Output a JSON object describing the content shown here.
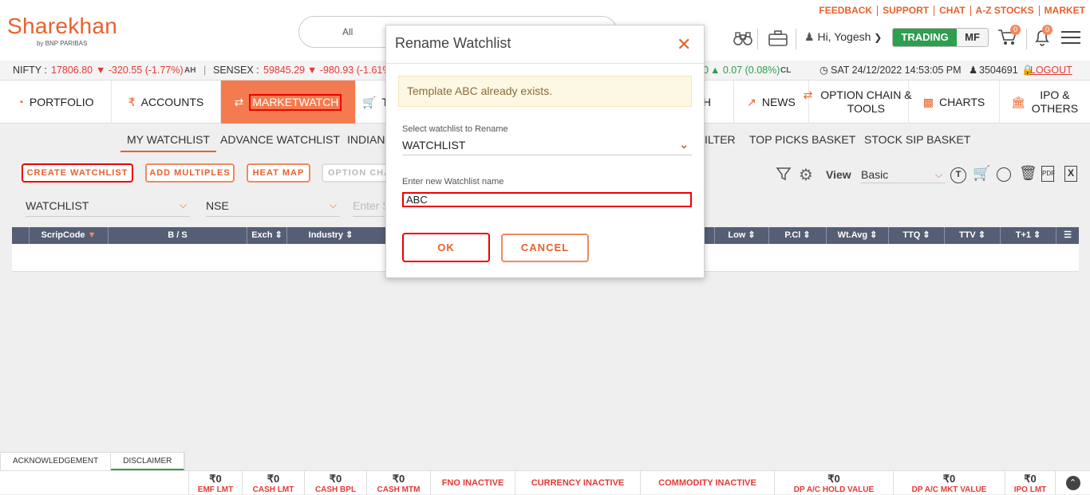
{
  "brand": {
    "name": "Sharekhan",
    "sub": "by BNP PARIBAS"
  },
  "toplinks": [
    "FEEDBACK",
    "SUPPORT",
    "CHAT",
    "A-Z STOCKS",
    "MARKET"
  ],
  "search": {
    "scope": "All"
  },
  "user": {
    "greeting": "Hi, Yogesh"
  },
  "mode": {
    "trading": "TRADING",
    "mf": "MF"
  },
  "badges": {
    "cart": "0",
    "bell": "0"
  },
  "ticker": {
    "nifty_label": "NIFTY :",
    "nifty_value": "17806.80",
    "nifty_change": "▼ -320.55 (-1.77%)",
    "nifty_tag": "AH",
    "sensex_label": "SENSEX :",
    "sensex_value": "59845.29",
    "sensex_change": "▼ -980.93 (-1.61%",
    "other_fragment": "0",
    "other_change": "▲ 0.07 (0.08%)",
    "other_tag": "CL",
    "datetime": "SAT 24/12/2022 14:53:05 PM",
    "user_id": "3504691",
    "logout": "LOGOUT"
  },
  "nav": {
    "portfolio": "PORTFOLIO",
    "accounts": "ACCOUNTS",
    "marketwatch": "MARKETWATCH",
    "trade_fragment": "TR",
    "h_fragment": "H",
    "news": "NEWS",
    "option": "OPTION CHAIN & TOOLS",
    "charts": "CHARTS",
    "ipo": "IPO & OTHERS"
  },
  "subtabs": {
    "my_watchlist": "MY WATCHLIST",
    "advance_watchlist": "ADVANCE WATCHLIST",
    "indian": "INDIAN",
    "filter": "ILTER",
    "top_picks": "TOP PICKS BASKET",
    "stock_sip": "STOCK SIP BASKET"
  },
  "actions": {
    "create": "CREATE WATCHLIST",
    "add_multiples": "ADD MULTIPLES",
    "heat_map": "HEAT MAP",
    "option_chain": "OPTION CHA"
  },
  "toolbar": {
    "view_label": "View",
    "view_value": "Basic"
  },
  "selectors": {
    "watchlist": "WATCHLIST",
    "exchange": "NSE",
    "enter_placeholder": "Enter S"
  },
  "table": {
    "headers": [
      "ScripCode",
      "B / S",
      "Exch",
      "Industry",
      "Low",
      "P.Cl",
      "Wt.Avg",
      "TTQ",
      "TTV",
      "T+1"
    ]
  },
  "modal": {
    "title": "Rename Watchlist",
    "alert": "Template ABC already exists.",
    "select_label": "Select watchlist to Rename",
    "select_value": "WATCHLIST",
    "input_label": "Enter new Watchlist name",
    "input_value": "ABC",
    "ok": "OK",
    "cancel": "CANCEL"
  },
  "bottom_tabs": {
    "ack": "ACKNOWLEDGEMENT",
    "disclaimer": "DISCLAIMER"
  },
  "footer": {
    "emf_value": "₹0",
    "emf_label": "EMF LMT",
    "cash_lmt_value": "₹0",
    "cash_lmt_label": "CASH LMT",
    "cash_bpl_value": "₹0",
    "cash_bpl_label": "CASH BPL",
    "cash_mtm_value": "₹0",
    "cash_mtm_label": "CASH MTM",
    "fno": "FNO INACTIVE",
    "currency": "CURRENCY INACTIVE",
    "commodity": "COMMODITY INACTIVE",
    "dp_hold_value": "₹0",
    "dp_hold_label": "DP A/C HOLD VALUE",
    "dp_mkt_value": "₹0",
    "dp_mkt_label": "DP A/C MKT VALUE",
    "ipo_value": "₹0",
    "ipo_label": "IPO LMT"
  },
  "colors": {
    "brand": "#e8612c",
    "trading": "#2e9e4f",
    "down": "#e53935",
    "table_header": "#545e75"
  }
}
